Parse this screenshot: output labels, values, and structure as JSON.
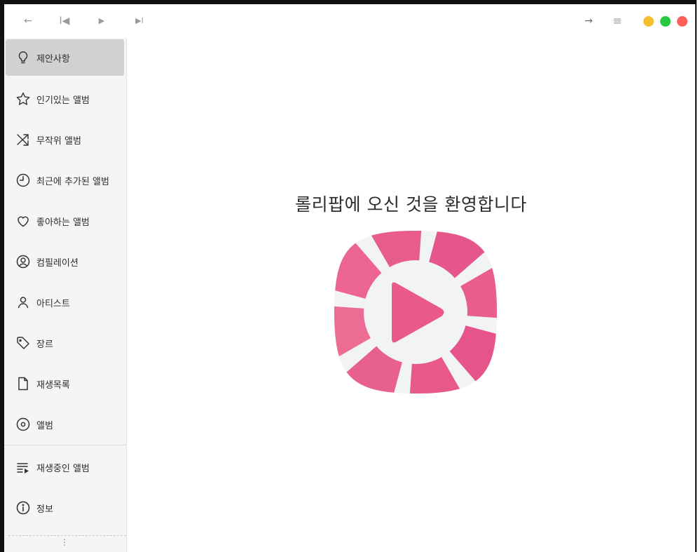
{
  "titlebar": {
    "buttons": {
      "back": "←",
      "previous": "I◀",
      "play": "▶",
      "next": "▶I",
      "forward": "→",
      "menu": "≡"
    },
    "window_controls": {
      "minimize_color": "#f5bf2b",
      "maximize_color": "#27c93f",
      "close_color": "#ff5f57"
    }
  },
  "sidebar": {
    "items": [
      {
        "label": "제안사항",
        "icon": "lightbulb-icon",
        "active": true
      },
      {
        "label": "인기있는 앨범",
        "icon": "star-icon",
        "active": false
      },
      {
        "label": "무작위 앨범",
        "icon": "shuffle-icon",
        "active": false
      },
      {
        "label": "최근에 추가된 앨범",
        "icon": "clock-icon",
        "active": false
      },
      {
        "label": "좋아하는 앨범",
        "icon": "heart-icon",
        "active": false
      },
      {
        "label": "컴필레이션",
        "icon": "compilation-icon",
        "active": false
      },
      {
        "label": "아티스트",
        "icon": "person-icon",
        "active": false
      },
      {
        "label": "장르",
        "icon": "tag-icon",
        "active": false
      },
      {
        "label": "재생목록",
        "icon": "document-icon",
        "active": false
      },
      {
        "label": "앨범",
        "icon": "disc-icon",
        "active": false
      }
    ],
    "secondary_items": [
      {
        "label": "재생중인 앨범",
        "icon": "queue-playing-icon"
      },
      {
        "label": "정보",
        "icon": "info-icon"
      }
    ],
    "more_glyph": "⋮"
  },
  "main": {
    "welcome_text": "롤리팝에 오신 것을 환영합니다",
    "logo_icon": "lollypop-logo-icon",
    "brand_colors": [
      "#e8588a",
      "#f2f3f4"
    ]
  }
}
